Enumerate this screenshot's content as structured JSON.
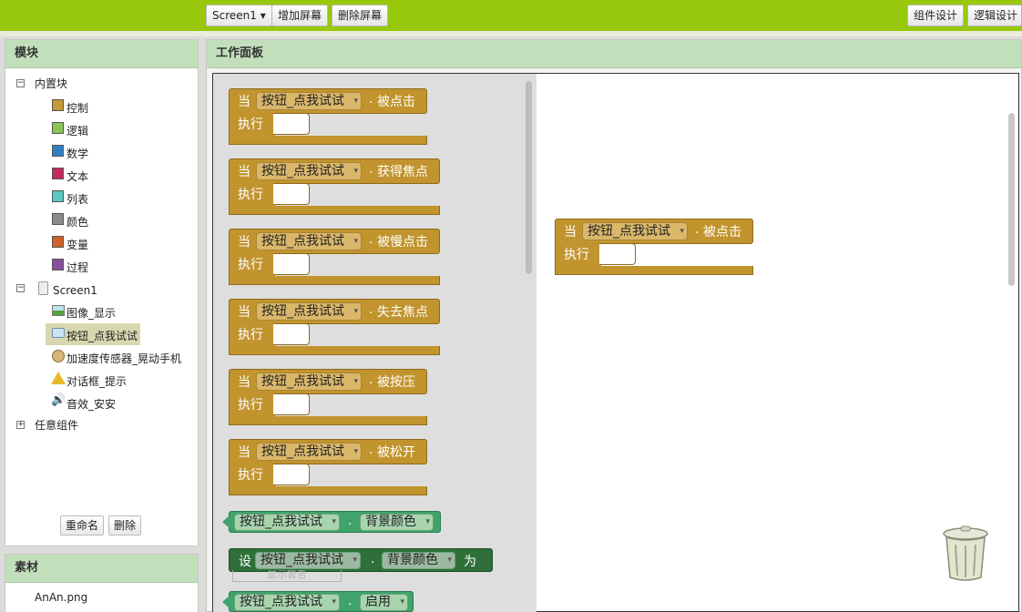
{
  "toolbar": {
    "screen_select": "Screen1 ▾",
    "add_screen": "增加屏幕",
    "remove_screen": "删除屏幕",
    "designer": "组件设计",
    "blocks": "逻辑设计"
  },
  "modules": {
    "title": "模块",
    "builtin": {
      "label": "内置块",
      "items": [
        {
          "label": "控制",
          "color": "#c49a33"
        },
        {
          "label": "逻辑",
          "color": "#8dc454"
        },
        {
          "label": "数学",
          "color": "#2f7ec4"
        },
        {
          "label": "文本",
          "color": "#c42b5b"
        },
        {
          "label": "列表",
          "color": "#59c9c3"
        },
        {
          "label": "颜色",
          "color": "#8c8c8c"
        },
        {
          "label": "变量",
          "color": "#d0612a"
        },
        {
          "label": "过程",
          "color": "#8a4f9c"
        }
      ]
    },
    "screen": {
      "label": "Screen1",
      "items": [
        {
          "label": "图像_显示",
          "icon": "image-icon"
        },
        {
          "label": "按钮_点我试试",
          "icon": "button-icon"
        },
        {
          "label": "加速度传感器_晃动手机",
          "icon": "accelerometer-icon"
        },
        {
          "label": "对话框_提示",
          "icon": "warning-icon"
        },
        {
          "label": "音效_安安",
          "icon": "sound-icon"
        }
      ]
    },
    "any": "任意组件",
    "rename": "重命名",
    "delete": "删除"
  },
  "media": {
    "title": "素材",
    "files": [
      "AnAn.png"
    ]
  },
  "workspace": {
    "title": "工作面板",
    "when": "当",
    "do": "执行",
    "set": "设",
    "to": "为",
    "dot": ".",
    "component": "按钮_点我试试",
    "events": [
      "被点击",
      "获得焦点",
      "被慢点击",
      "失去焦点",
      "被按压",
      "被松开"
    ],
    "getter_property": "背景颜色",
    "setter_property": "背景颜色",
    "enabled_property": "启用",
    "placed_event": "被点击",
    "ghost_text": "显示警告"
  }
}
